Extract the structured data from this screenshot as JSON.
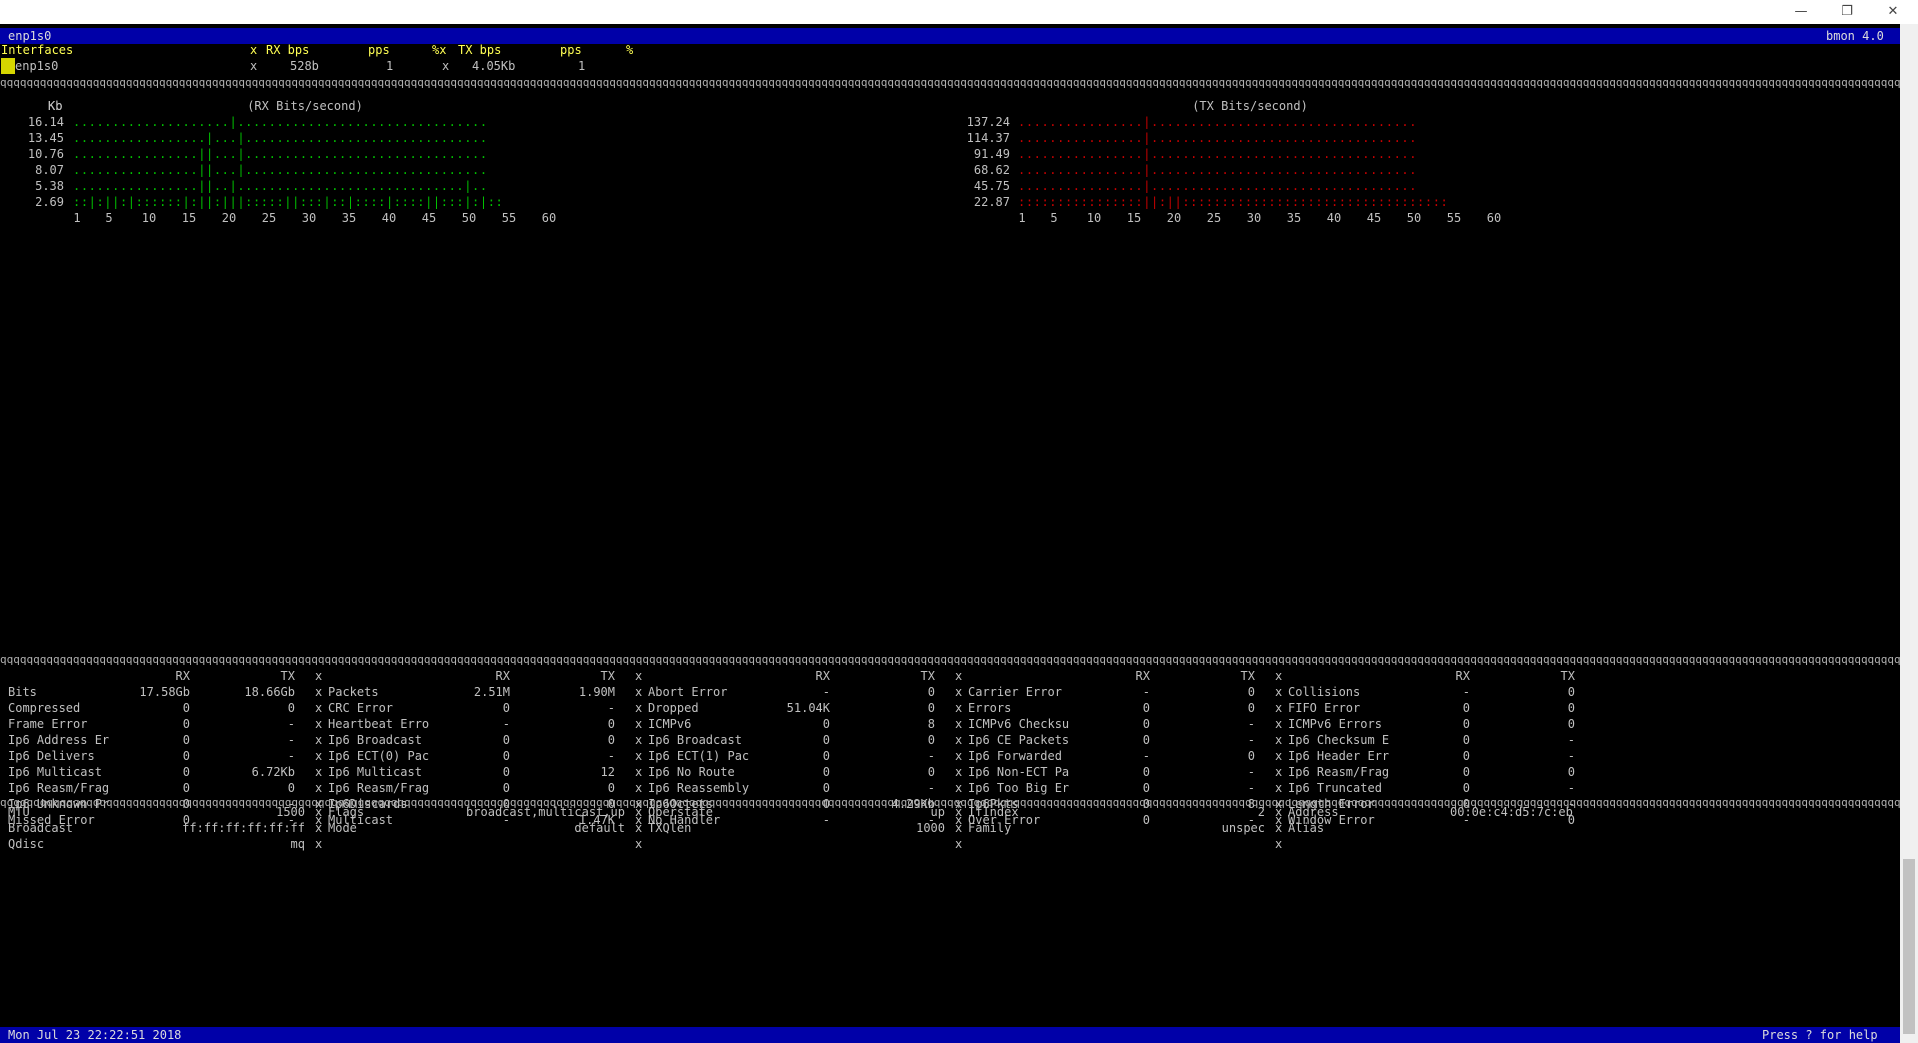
{
  "window": {
    "controls": {
      "minimize": "—",
      "restore": "❐",
      "close": "✕"
    }
  },
  "top_bar": {
    "left": "enp1s0",
    "right": "bmon 4.0"
  },
  "list": {
    "header": {
      "col1": "Interfaces",
      "x1": "x",
      "rx_bps": "RX bps",
      "rx_pps": "pps",
      "pct_x": "%x",
      "tx_bps": "TX bps",
      "tx_pps": "pps",
      "pct": "%"
    },
    "row": {
      "name": "enp1s0",
      "x1": "x",
      "rx_bps": "528b",
      "rx_pps": "1",
      "x2": "x",
      "tx_bps": "4.05Kb",
      "tx_pps": "1"
    }
  },
  "rx_graph": {
    "unit": "Kb",
    "title": "(RX Bits/second)",
    "y_ticks": [
      "16.14",
      "13.45",
      "10.76",
      "8.07",
      "5.38",
      "2.69"
    ],
    "x_ticks": [
      "1",
      "5",
      "10",
      "15",
      "20",
      "25",
      "30",
      "35",
      "40",
      "45",
      "50",
      "55",
      "60"
    ],
    "color": "#00c000",
    "lines": [
      "....................|................................",
      ".................|...|...............................",
      "................||...|...............................",
      "................||...|...............................",
      "................||..|.............................|..",
      "::|:||:|::::::|:||:|||:::::||:::|::|::::|::::||:::|:|::"
    ]
  },
  "tx_graph": {
    "unit": "Kb",
    "title": "(TX Bits/second)",
    "y_ticks": [
      "137.24",
      "114.37",
      "91.49",
      "68.62",
      "45.75",
      "22.87"
    ],
    "x_ticks": [
      "1",
      "5",
      "10",
      "15",
      "20",
      "25",
      "30",
      "35",
      "40",
      "45",
      "50",
      "55",
      "60"
    ],
    "color": "#c80000",
    "lines": [
      "................|..................................",
      "................|..................................",
      "................|..................................",
      "................|..................................",
      "................|..................................",
      "::::::::::::::::||:||::::::::::::::::::::::::::::::::::"
    ]
  },
  "stats": {
    "headers": [
      [
        "RX",
        "TX"
      ],
      [
        "RX",
        "TX"
      ],
      [
        "RX",
        "TX"
      ],
      [
        "RX",
        "TX"
      ],
      [
        "RX",
        "TX"
      ]
    ],
    "rows": [
      [
        [
          "Bits",
          "17.58Gb",
          "18.66Gb"
        ],
        [
          "Packets",
          "2.51M",
          "1.90M"
        ],
        [
          "Abort Error",
          "-",
          "0"
        ],
        [
          "Carrier Error",
          "-",
          "0"
        ],
        [
          "Collisions",
          "-",
          "0"
        ]
      ],
      [
        [
          "Compressed",
          "0",
          "0"
        ],
        [
          "CRC Error",
          "0",
          "-"
        ],
        [
          "Dropped",
          "51.04K",
          "0"
        ],
        [
          "Errors",
          "0",
          "0"
        ],
        [
          "FIFO Error",
          "0",
          "0"
        ]
      ],
      [
        [
          "Frame Error",
          "0",
          "-"
        ],
        [
          "Heartbeat Erro",
          "-",
          "0"
        ],
        [
          "ICMPv6",
          "0",
          "8"
        ],
        [
          "ICMPv6 Checksu",
          "0",
          "-"
        ],
        [
          "ICMPv6 Errors",
          "0",
          "0"
        ]
      ],
      [
        [
          "Ip6 Address Er",
          "0",
          "-"
        ],
        [
          "Ip6 Broadcast",
          "0",
          "0"
        ],
        [
          "Ip6 Broadcast",
          "0",
          "0"
        ],
        [
          "Ip6 CE Packets",
          "0",
          "-"
        ],
        [
          "Ip6 Checksum E",
          "0",
          "-"
        ]
      ],
      [
        [
          "Ip6 Delivers",
          "0",
          "-"
        ],
        [
          "Ip6 ECT(0) Pac",
          "0",
          "-"
        ],
        [
          "Ip6 ECT(1) Pac",
          "0",
          "-"
        ],
        [
          "Ip6 Forwarded",
          "-",
          "0"
        ],
        [
          "Ip6 Header Err",
          "0",
          "-"
        ]
      ],
      [
        [
          "Ip6 Multicast",
          "0",
          "6.72Kb"
        ],
        [
          "Ip6 Multicast",
          "0",
          "12"
        ],
        [
          "Ip6 No Route",
          "0",
          "0"
        ],
        [
          "Ip6 Non-ECT Pa",
          "0",
          "-"
        ],
        [
          "Ip6 Reasm/Frag",
          "0",
          "0"
        ]
      ],
      [
        [
          "Ip6 Reasm/Frag",
          "0",
          "0"
        ],
        [
          "Ip6 Reasm/Frag",
          "0",
          "0"
        ],
        [
          "Ip6 Reassembly",
          "0",
          "-"
        ],
        [
          "Ip6 Too Big Er",
          "0",
          "-"
        ],
        [
          "Ip6 Truncated",
          "0",
          "-"
        ]
      ],
      [
        [
          "Ip6 Unknown Pr",
          "0",
          "-"
        ],
        [
          "Ip6Discards",
          "0",
          "0"
        ],
        [
          "Ip6Octets",
          "0",
          "4.29Kb"
        ],
        [
          "Ip6Pkts",
          "0",
          "8"
        ],
        [
          "Length Error",
          "0",
          "-"
        ]
      ],
      [
        [
          "Missed Error",
          "0",
          "-"
        ],
        [
          "Multicast",
          "-",
          "1.47K"
        ],
        [
          "No Handler",
          "-",
          "-"
        ],
        [
          "Over Error",
          "0",
          "-"
        ],
        [
          "Window Error",
          "-",
          "0"
        ]
      ]
    ]
  },
  "info": {
    "rows": [
      [
        [
          "MTU",
          "1500"
        ],
        [
          "Flags",
          "broadcast,multicast,up"
        ],
        [
          "Operstate",
          "up"
        ],
        [
          "IfIndex",
          "2"
        ],
        [
          "Address",
          "00:0e:c4:d5:7c:eb"
        ]
      ],
      [
        [
          "Broadcast",
          "ff:ff:ff:ff:ff:ff"
        ],
        [
          "Mode",
          "default"
        ],
        [
          "TXQlen",
          "1000"
        ],
        [
          "Family",
          "unspec"
        ],
        [
          "Alias",
          ""
        ]
      ],
      [
        [
          "Qdisc",
          "mq"
        ],
        [
          "",
          ""
        ],
        [
          "",
          ""
        ],
        [
          "",
          ""
        ],
        [
          "",
          ""
        ]
      ]
    ]
  },
  "bottom_bar": {
    "left": "Mon Jul 23 22:22:51 2018",
    "right": "Press ? for help"
  },
  "separator_char": "q",
  "column_sep": "x"
}
